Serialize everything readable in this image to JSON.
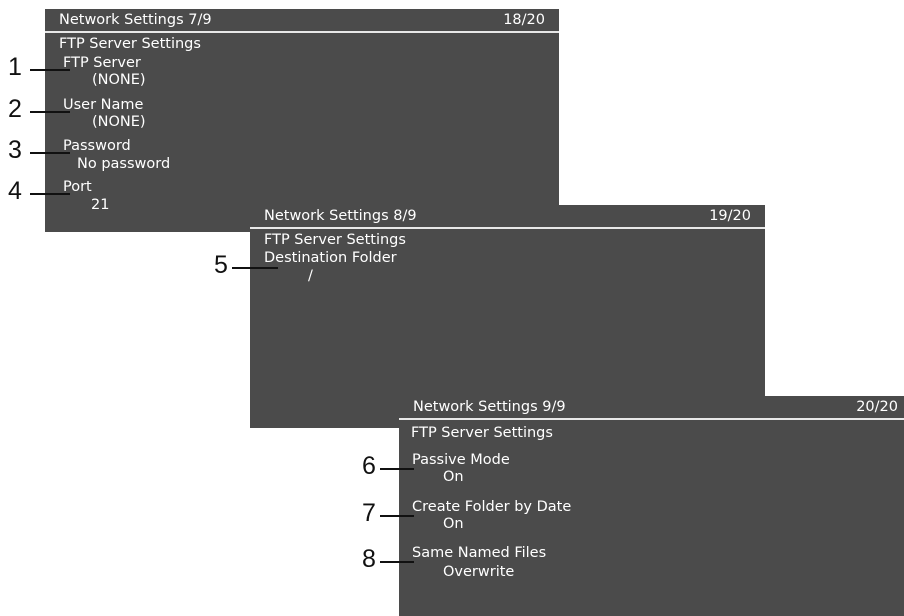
{
  "screens": [
    {
      "title": "Network Settings 7/9",
      "page": "18/20",
      "section": "FTP Server Settings",
      "items": [
        {
          "callout": "1",
          "label": "FTP Server",
          "value": "(NONE)"
        },
        {
          "callout": "2",
          "label": "User Name",
          "value": "(NONE)"
        },
        {
          "callout": "3",
          "label": "Password",
          "value": "No password"
        },
        {
          "callout": "4",
          "label": "Port",
          "value": "21"
        }
      ]
    },
    {
      "title": "Network Settings 8/9",
      "page": "19/20",
      "section": "FTP Server Settings",
      "items": [
        {
          "callout": "5",
          "label": "Destination Folder",
          "value": "/"
        }
      ]
    },
    {
      "title": "Network Settings 9/9",
      "page": "20/20",
      "section": "FTP Server Settings",
      "items": [
        {
          "callout": "6",
          "label": "Passive Mode",
          "value": "On"
        },
        {
          "callout": "7",
          "label": "Create Folder by Date",
          "value": "On"
        },
        {
          "callout": "8",
          "label": "Same Named Files",
          "value": "Overwrite"
        }
      ]
    }
  ]
}
